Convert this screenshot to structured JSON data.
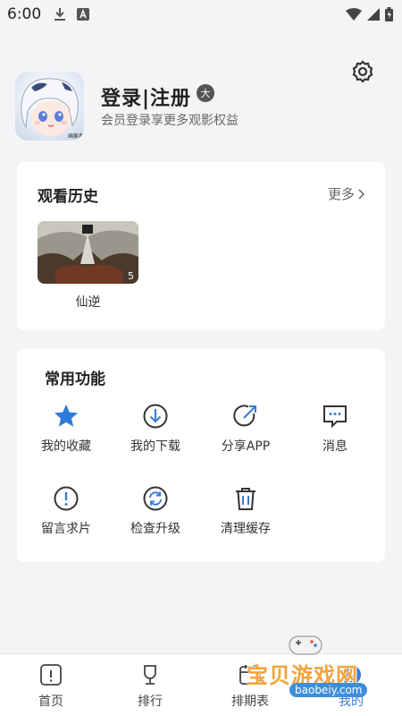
{
  "status_bar": {
    "time": "6:00",
    "left_icons": [
      "download-icon",
      "a-box-icon"
    ],
    "right_icons": [
      "wifi-icon",
      "signal-icon",
      "battery-icon"
    ]
  },
  "profile": {
    "login_label": "登录|注册",
    "level_badge": "大",
    "subtitle": "会员登录享更多观影权益",
    "avatar_stamp": "画家君"
  },
  "history": {
    "title": "观看历史",
    "more_label": "更多",
    "items": [
      {
        "title": "仙逆",
        "episode": "5"
      }
    ]
  },
  "functions": {
    "title": "常用功能",
    "items": [
      {
        "label": "我的收藏",
        "icon": "star-icon"
      },
      {
        "label": "我的下载",
        "icon": "download-circle-icon"
      },
      {
        "label": "分享APP",
        "icon": "share-icon"
      },
      {
        "label": "消息",
        "icon": "message-icon"
      },
      {
        "label": "留言求片",
        "icon": "exclamation-icon"
      },
      {
        "label": "检查升级",
        "icon": "refresh-icon"
      },
      {
        "label": "清理缓存",
        "icon": "trash-icon"
      }
    ]
  },
  "bottom_nav": {
    "items": [
      {
        "label": "首页",
        "icon": "home-icon"
      },
      {
        "label": "排行",
        "icon": "trophy-icon"
      },
      {
        "label": "排期表",
        "icon": "calendar-icon"
      },
      {
        "label": "我的",
        "icon": "user-icon",
        "active": true
      }
    ]
  },
  "watermark": {
    "text": "宝贝游戏网",
    "url": "baobeiy.com"
  },
  "colors": {
    "accent": "#3a7bd5",
    "star": "#2f7bd8",
    "background": "#f4f4f6",
    "card": "#ffffff"
  }
}
